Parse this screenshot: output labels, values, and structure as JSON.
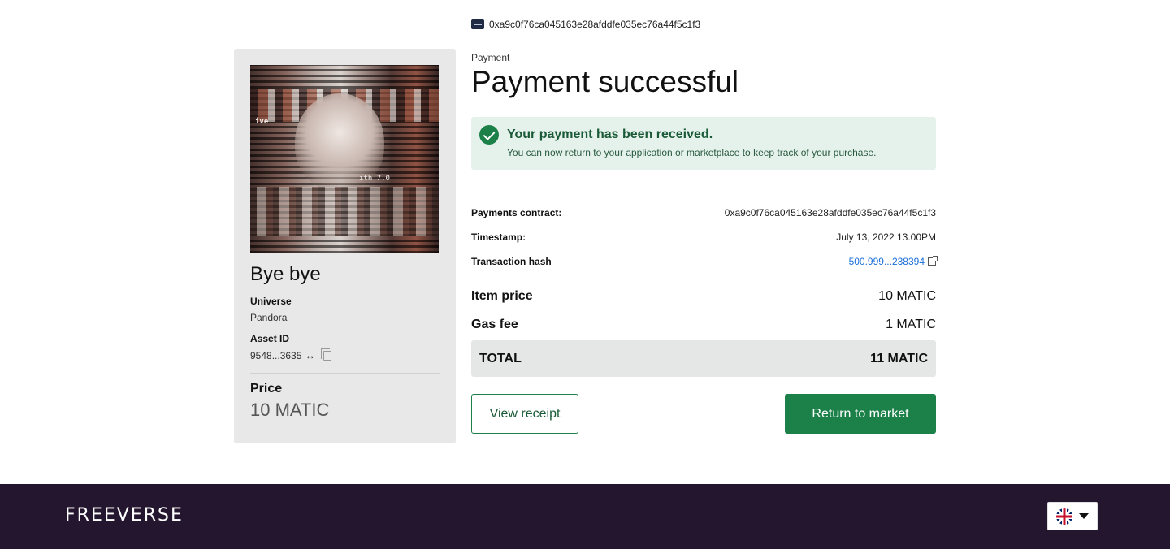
{
  "wallet": {
    "address": "0xa9c0f76ca045163e28afddfe035ec76a44f5c1f3",
    "icon": "wallet-icon"
  },
  "asset": {
    "title": "Bye bye",
    "universe_label": "Universe",
    "universe_value": "Pandora",
    "asset_id_label": "Asset ID",
    "asset_id_value": "9548...3635",
    "price_label": "Price",
    "price_value": "10 MATIC",
    "image_text_1": "ith 7.0",
    "image_text_2": "ive"
  },
  "header": {
    "overline": "Payment",
    "title": "Payment successful"
  },
  "alert": {
    "title": "Your payment has been received.",
    "text": "You can now return to your application or marketplace to keep track of your purchase.",
    "color": "#1c8049"
  },
  "details": [
    {
      "label": "Payments contract:",
      "value": "0xa9c0f76ca045163e28afddfe035ec76a44f5c1f3"
    },
    {
      "label": "Timestamp:",
      "value": "July 13, 2022 13.00PM"
    },
    {
      "label": "Transaction hash",
      "value": "500.999...238394"
    }
  ],
  "prices": {
    "item_label": "Item price",
    "item_value": "10 MATIC",
    "gas_label": "Gas fee",
    "gas_value": "1 MATIC",
    "total_label": "TOTAL",
    "total_value": "11 MATIC"
  },
  "actions": {
    "view_receipt": "View receipt",
    "return_to_market": "Return to market"
  },
  "footer": {
    "logo": "FREEVERSE",
    "language": "en-GB",
    "background": "#24162e"
  }
}
